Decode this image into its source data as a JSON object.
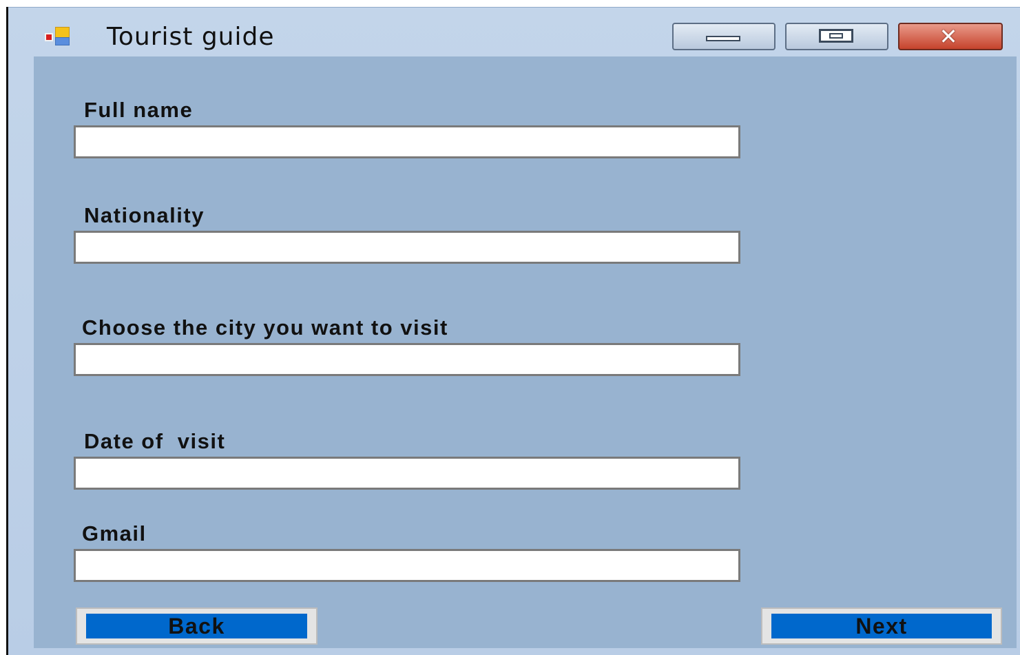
{
  "window": {
    "title": "Tourist guide",
    "icon": "application-icon",
    "controls": {
      "minimize": "minimize-icon",
      "maximize": "maximize-icon",
      "close": "close-icon"
    }
  },
  "form": {
    "fields": [
      {
        "label": "Full name",
        "value": "",
        "placeholder": ""
      },
      {
        "label": "Nationality",
        "value": "",
        "placeholder": ""
      },
      {
        "label": "Choose the city you want to visit",
        "value": "",
        "placeholder": ""
      },
      {
        "label": "Date of  visit",
        "value": "",
        "placeholder": ""
      },
      {
        "label": "Gmail",
        "value": "",
        "placeholder": ""
      }
    ],
    "buttons": {
      "back_label": "Back",
      "next_label": "Next"
    }
  },
  "colors": {
    "client_background": "#98b3d0",
    "button_face": "#0068cc",
    "close_button": "#c6432c"
  }
}
